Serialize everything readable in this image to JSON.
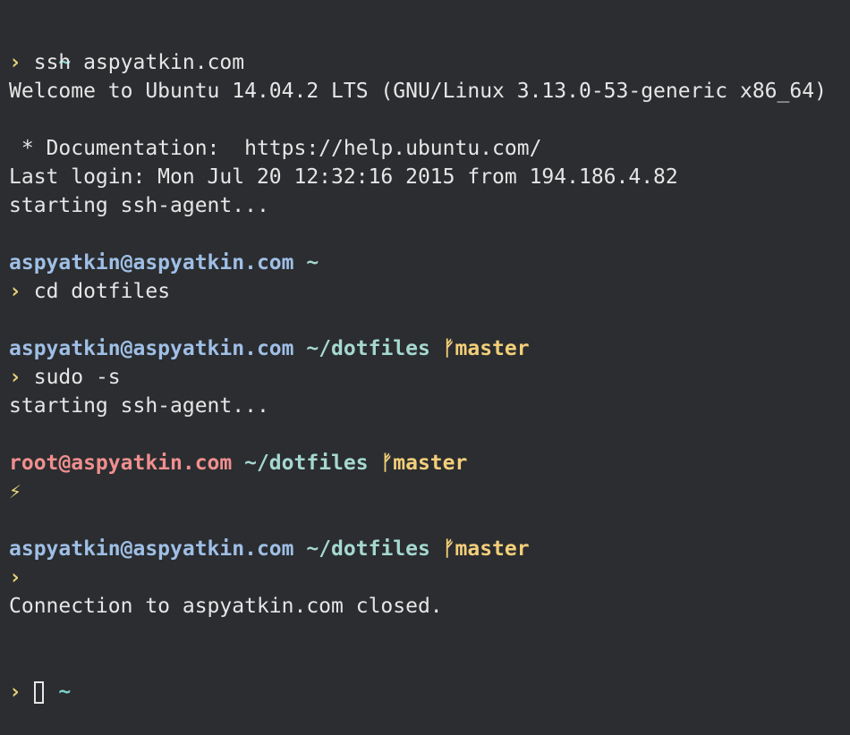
{
  "colors": {
    "background": "#2b2d30",
    "text": "#e6e6e6",
    "prompt_caret": "#e6d47a",
    "user": "#9fbfe6",
    "root_user": "#f08f8f",
    "path": "#a6d8d0",
    "branch": "#f3cf7a",
    "tilde": "#7fd0c8"
  },
  "terminal": {
    "tilde": "~",
    "caret": "›",
    "bolt": "⚡",
    "cmd_ssh": "ssh aspyatkin.com",
    "welcome": "Welcome to Ubuntu 14.04.2 LTS (GNU/Linux 3.13.0-53-generic x86_64)",
    "documentation": " * Documentation:  https://help.ubuntu.com/",
    "last_login": "Last login: Mon Jul 20 12:32:16 2015 from 194.186.4.82",
    "agent1": "starting ssh-agent...",
    "prompt1_user": "aspyatkin@aspyatkin.com",
    "prompt1_path": "~",
    "cmd_cd": "cd dotfiles",
    "prompt2_user": "aspyatkin@aspyatkin.com",
    "prompt2_path": "~/dotfiles",
    "branch_icon": "ᚠ",
    "prompt2_branch": "master",
    "cmd_sudo": "sudo -s",
    "agent2": "starting ssh-agent...",
    "prompt3_user": "root@aspyatkin.com",
    "prompt3_path": "~/dotfiles",
    "prompt3_branch": "master",
    "prompt4_user": "aspyatkin@aspyatkin.com",
    "prompt4_path": "~/dotfiles",
    "prompt4_branch": "master",
    "closed": "Connection to aspyatkin.com closed."
  }
}
